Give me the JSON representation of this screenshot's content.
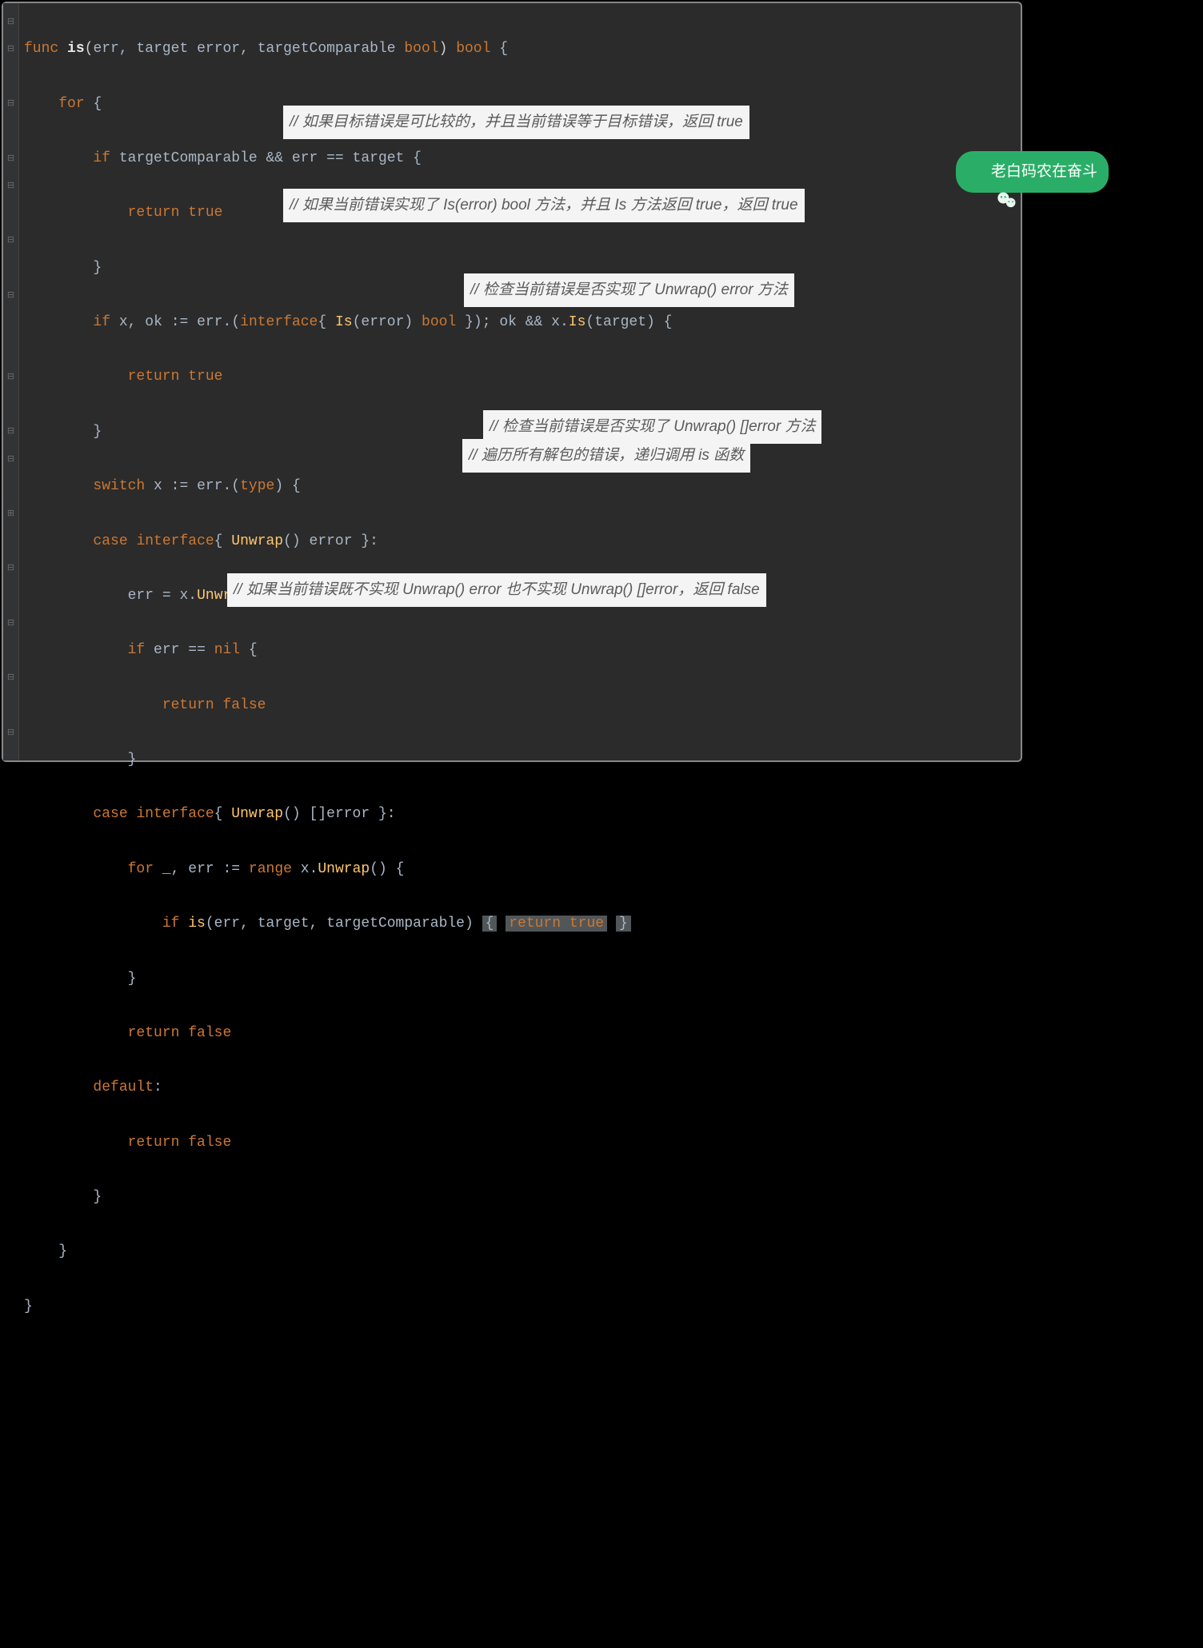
{
  "code": {
    "l1": {
      "func": "func",
      "name": "is",
      "p_err": "err",
      "p_target": "target",
      "t_error": "error",
      "p_tc": "targetComparable",
      "t_bool": "bool",
      "ret": "bool",
      "open": "{"
    },
    "l2": {
      "for": "for",
      "open": "{"
    },
    "l3": {
      "if": "if",
      "tc": "targetComparable",
      "and": "&&",
      "err": "err",
      "eq": "==",
      "target": "target",
      "open": "{"
    },
    "l4": {
      "return": "return",
      "true": "true"
    },
    "l5": {
      "close": "}"
    },
    "l6": {
      "if": "if",
      "x": "x",
      "c1": ",",
      "ok": "ok",
      "assign": ":=",
      "err": "err",
      "dot": ".(",
      "interface": "interface",
      "ob": "{",
      "Is": "Is",
      "oparen": "(",
      "error": "error",
      "cparen": ")",
      "bool": "bool",
      "cb": "}",
      "close_assert": ")",
      "semi": ";",
      "ok2": "ok",
      "and": "&&",
      "x2": "x",
      "dot2": ".",
      "Is2": "Is",
      "op2": "(",
      "target": "target",
      "cp2": ")",
      "open": "{"
    },
    "l7": {
      "return": "return",
      "true": "true"
    },
    "l8": {
      "close": "}"
    },
    "l9": {
      "switch": "switch",
      "x": "x",
      "assign": ":=",
      "err": "err",
      "dot": ".(",
      "type": "type",
      "cparen": ")",
      "open": "{"
    },
    "l10": {
      "case": "case",
      "interface": "interface",
      "ob": "{",
      "Unwrap": "Unwrap",
      "op": "()",
      "error": "error",
      "cb": "}",
      "colon": ":"
    },
    "l11": {
      "err": "err",
      "eq": "=",
      "x": "x",
      "dot": ".",
      "Unwrap": "Unwrap",
      "op": "()"
    },
    "l12": {
      "if": "if",
      "err": "err",
      "eq": "==",
      "nil": "nil",
      "open": "{"
    },
    "l13": {
      "return": "return",
      "false": "false"
    },
    "l14": {
      "close": "}"
    },
    "l15": {
      "case": "case",
      "interface": "interface",
      "ob": "{",
      "Unwrap": "Unwrap",
      "op": "()",
      "br": "[]",
      "error": "error",
      "cb": "}",
      "colon": ":"
    },
    "l16": {
      "for": "for",
      "us": "_",
      "c": ",",
      "err": "err",
      "assign": ":=",
      "range": "range",
      "x": "x",
      "dot": ".",
      "Unwrap": "Unwrap",
      "op": "()",
      "open": "{"
    },
    "l17": {
      "if": "if",
      "is": "is",
      "op": "(",
      "err": "err",
      "c1": ",",
      "target": "target",
      "c2": ",",
      "tc": "targetComparable",
      "cp": ")",
      "ob": "{",
      "return": "return",
      "true": "true",
      "cb": "}"
    },
    "l18": {
      "close": "}"
    },
    "l19": {
      "return": "return",
      "false": "false"
    },
    "l20": {
      "default": "default",
      "colon": ":"
    },
    "l21": {
      "return": "return",
      "false": "false"
    },
    "l22": {
      "close": "}"
    },
    "l23": {
      "close": "}"
    },
    "l24": {
      "close": "}"
    }
  },
  "comments": {
    "c1": "// 如果目标错误是可比较的，并且当前错误等于目标错误，返回 true",
    "c2": "// 如果当前错误实现了 Is(error) bool 方法，并且 Is 方法返回 true，返回 true",
    "c3": "// 检查当前错误是否实现了 Unwrap() error 方法",
    "c4": "// 检查当前错误是否实现了 Unwrap() []error 方法",
    "c5": "// 遍历所有解包的错误，递归调用 is 函数",
    "c6": "// 如果当前错误既不实现 Unwrap() error 也不实现 Unwrap() []error，返回 false"
  },
  "badge": {
    "text": "老白码农在奋斗"
  },
  "gutter": {
    "marks": [
      "⊟",
      "⊟",
      "",
      "⊟",
      "",
      "⊟",
      "⊟",
      "",
      "⊟",
      "",
      "⊟",
      "",
      "",
      "⊟",
      "",
      "⊟",
      "⊟",
      "",
      "⊞",
      "",
      "⊟",
      "",
      "⊟",
      "",
      "⊟",
      "",
      "⊟"
    ]
  }
}
